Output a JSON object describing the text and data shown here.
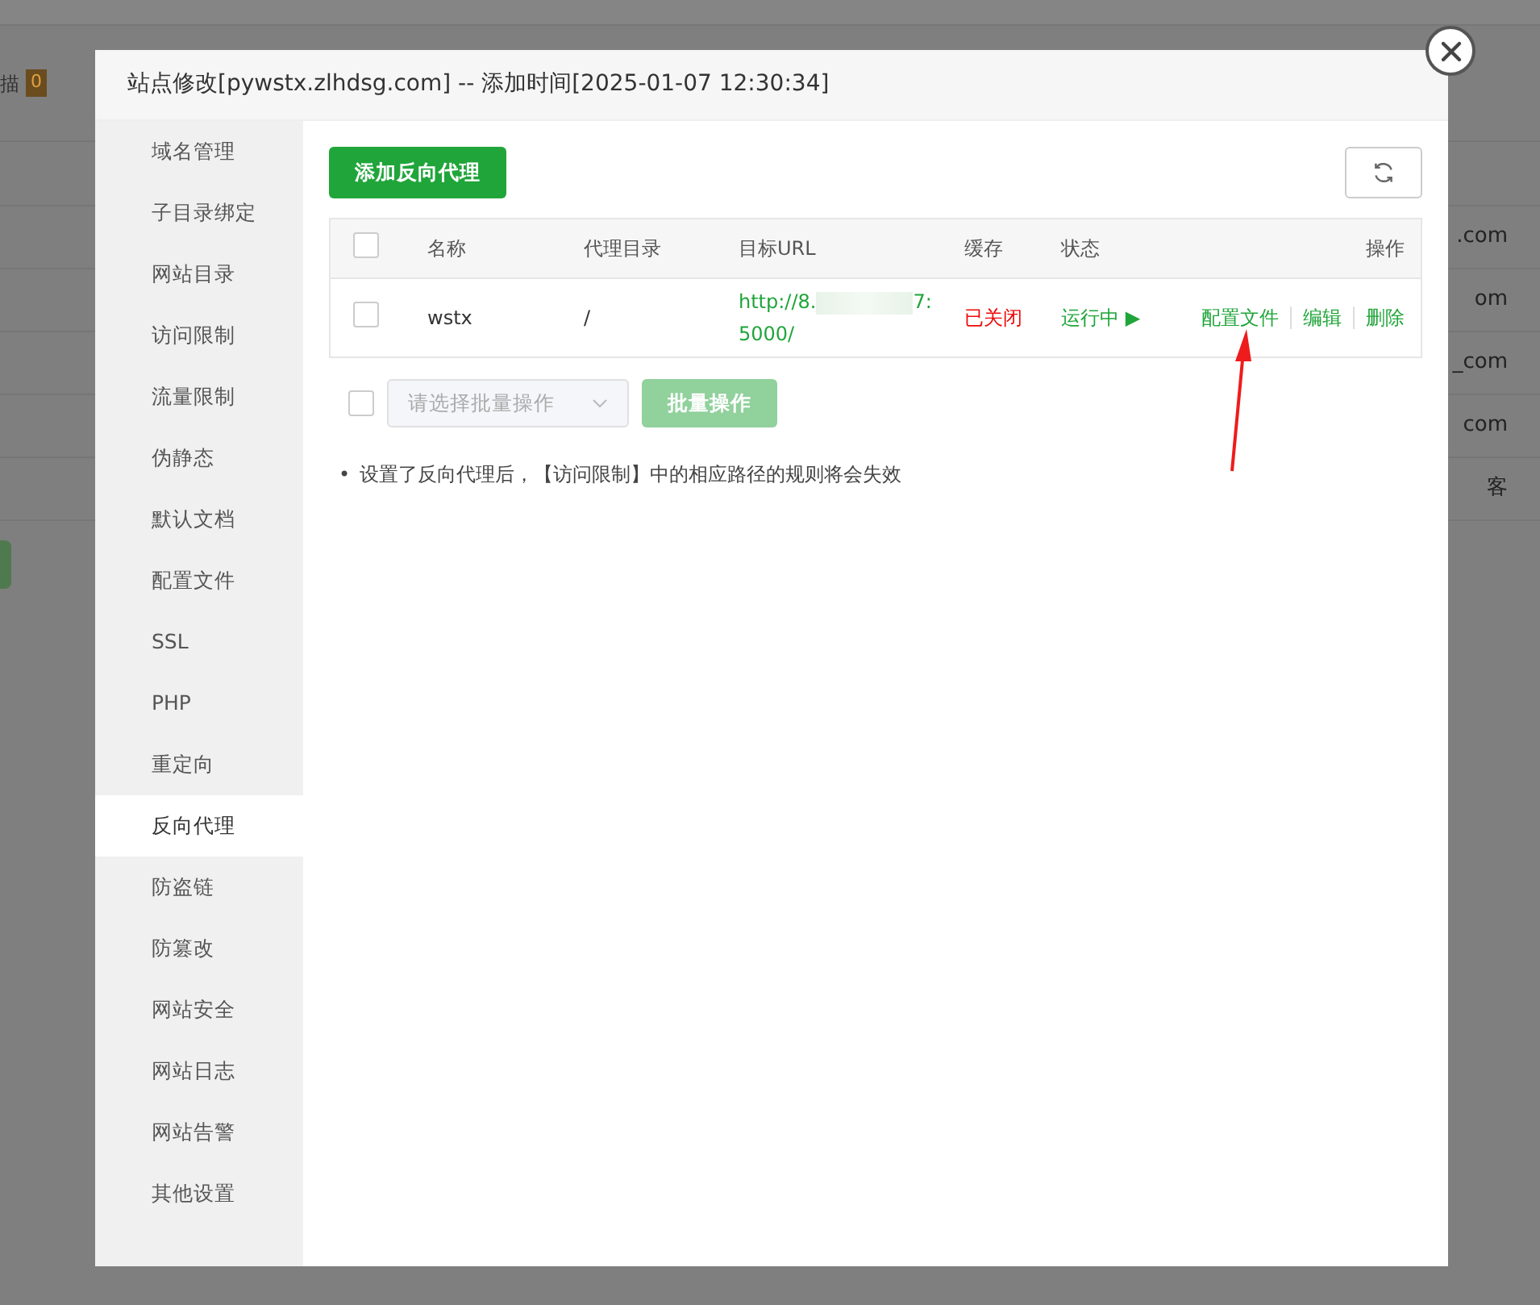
{
  "background": {
    "filter_label": "描",
    "filter_count": "0",
    "rows": [
      {
        "site": ".com"
      },
      {
        "site": "om"
      },
      {
        "site": "_com"
      },
      {
        "site": "com"
      },
      {
        "site": "客"
      }
    ]
  },
  "dialog": {
    "title": "站点修改[pywstx.zlhdsg.com] -- 添加时间[2025-01-07 12:30:34]",
    "sidebar": [
      {
        "label": "域名管理",
        "selected": false
      },
      {
        "label": "子目录绑定",
        "selected": false
      },
      {
        "label": "网站目录",
        "selected": false
      },
      {
        "label": "访问限制",
        "selected": false
      },
      {
        "label": "流量限制",
        "selected": false
      },
      {
        "label": "伪静态",
        "selected": false
      },
      {
        "label": "默认文档",
        "selected": false
      },
      {
        "label": "配置文件",
        "selected": false
      },
      {
        "label": "SSL",
        "selected": false
      },
      {
        "label": "PHP",
        "selected": false
      },
      {
        "label": "重定向",
        "selected": false
      },
      {
        "label": "反向代理",
        "selected": true
      },
      {
        "label": "防盗链",
        "selected": false
      },
      {
        "label": "防篡改",
        "selected": false
      },
      {
        "label": "网站安全",
        "selected": false
      },
      {
        "label": "网站日志",
        "selected": false
      },
      {
        "label": "网站告警",
        "selected": false
      },
      {
        "label": "其他设置",
        "selected": false
      }
    ],
    "add_button": "添加反向代理",
    "table": {
      "all_checked": false,
      "columns": [
        "名称",
        "代理目录",
        "目标URL",
        "缓存",
        "状态",
        "操作"
      ],
      "rows": [
        {
          "checked": false,
          "name": "wstx",
          "directory": "/",
          "url_start": "http://8.",
          "url_end": "7:",
          "url_line2": "5000/",
          "cache": "已关闭",
          "cache_on": false,
          "status": "运行中",
          "status_icon": "▶",
          "running": true,
          "actions": [
            "配置文件",
            "编辑",
            "删除"
          ]
        }
      ]
    },
    "batch": {
      "checked": false,
      "placeholder": "请选择批量操作",
      "button": "批量操作",
      "disabled": true
    },
    "notes": [
      {
        "marker": "•",
        "text": "设置了反向代理后，【访问限制】中的相应路径的规则将会失效"
      }
    ]
  }
}
